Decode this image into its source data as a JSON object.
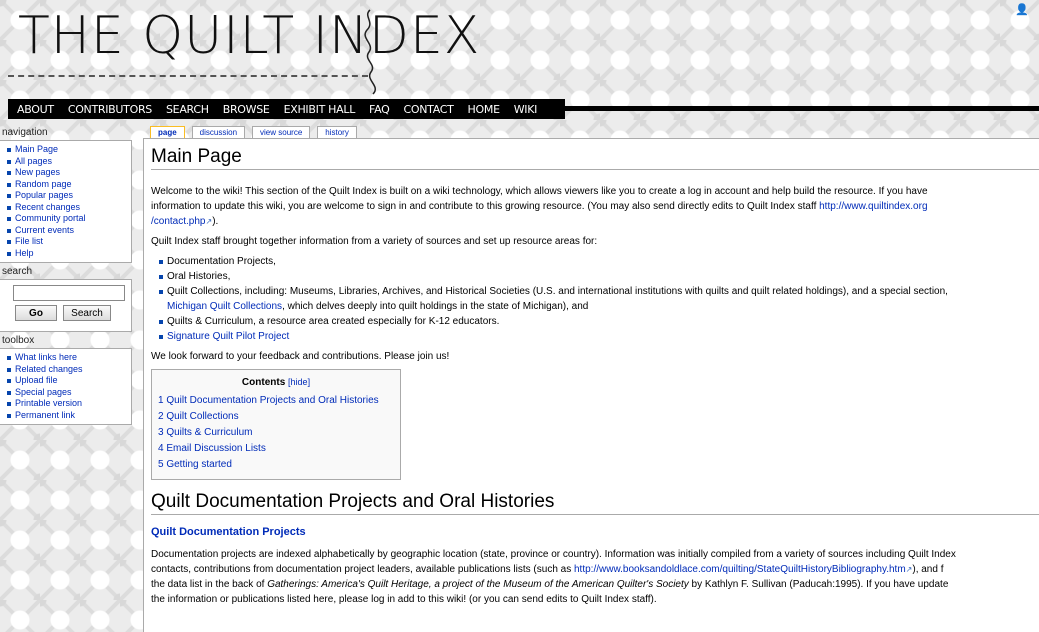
{
  "site": {
    "logo_text": "THE QUILT INDEX"
  },
  "topnav": [
    "ABOUT",
    "CONTRIBUTORS",
    "SEARCH",
    "BROWSE",
    "EXHIBIT HALL",
    "FAQ",
    "CONTACT",
    "HOME",
    "WIKI"
  ],
  "sidebar": {
    "navigation_title": "navigation",
    "navigation": [
      "Main Page",
      "All pages",
      "New pages",
      "Random page",
      "Popular pages",
      "Recent changes",
      "Community portal",
      "Current events",
      "File list",
      "Help"
    ],
    "search_title": "search",
    "search_placeholder": "",
    "go_label": "Go",
    "search_label": "Search",
    "toolbox_title": "toolbox",
    "toolbox": [
      "What links here",
      "Related changes",
      "Upload file",
      "Special pages",
      "Printable version",
      "Permanent link"
    ]
  },
  "tabs": [
    "page",
    "discussion",
    "view source",
    "history"
  ],
  "content": {
    "title": "Main Page",
    "intro_1": "Welcome to the wiki! This section of the Quilt Index is built on a wiki technology, which allows viewers like you to create a log in account and help build the resource. If you have",
    "intro_2": "information to update this wiki, you are welcome to sign in and contribute to this growing resource. (You may also send directly edits to Quilt Index staff ",
    "intro_2_link": "http://www.quiltindex.org",
    "intro_3_link": "/contact.php",
    "intro_3_end": ").",
    "resources_intro": "Quilt Index staff brought together information from a variety of sources and set up resource areas for:",
    "bullets": {
      "b1": "Documentation Projects,",
      "b2": "Oral Histories,",
      "b3": "Quilt Collections, including: Museums, Libraries, Archives, and Historical Societies (U.S. and international institutions with quilts and quilt related holdings), and a special section,",
      "b3_link": "Michigan Quilt Collections",
      "b3_rest": ", which delves deeply into quilt holdings in the state of Michigan), and",
      "b4": "Quilts & Curriculum, a resource area created especially for K-12 educators.",
      "b5_link": "Signature Quilt Pilot Project"
    },
    "feedback": "We look forward to your feedback and contributions. Please join us!",
    "toc": {
      "title": "Contents",
      "hide": "[hide]",
      "items": [
        "1 Quilt Documentation Projects and Oral Histories",
        "2 Quilt Collections",
        "3 Quilts & Curriculum",
        "4 Email Discussion Lists",
        "5 Getting started"
      ]
    },
    "section_title": "Quilt Documentation Projects and Oral Histories",
    "subsection_title": "Quilt Documentation Projects",
    "doc_1": "Documentation projects are indexed alphabetically by geographic location (state, province or country). Information was initially compiled from a variety of sources including Quilt Index",
    "doc_2": "contacts, contributions from documentation project leaders, available publications lists (such as ",
    "doc_2_link": "http://www.booksandoldlace.com/quilting/StateQuiltHistoryBibliography.htm",
    "doc_2_end": "), and f",
    "doc_3_a": "the data list in the back of ",
    "doc_3_italic_1": "Gatherings: America's Quilt Heritage, a project of the Museum of the American Quilter's Society",
    "doc_3_b": " by Kathlyn F. Sullivan (Paducah:1995). If you have update",
    "doc_4": "the information or publications listed here, please log in add to this wiki! (or you can send edits to Quilt Index staff)."
  }
}
